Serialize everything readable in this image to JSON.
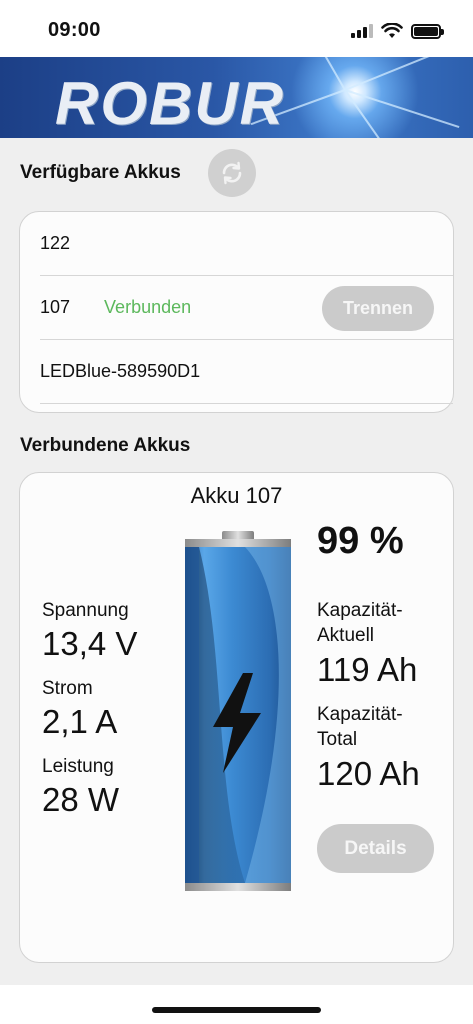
{
  "status_bar": {
    "time": "09:00"
  },
  "banner": {
    "logo_text": "ROBUR"
  },
  "available": {
    "title": "Verfügbare Akkus",
    "devices": [
      {
        "name": "122",
        "status": "",
        "action": ""
      },
      {
        "name": "107",
        "status": "Verbunden",
        "action": "Trennen"
      },
      {
        "name": "LEDBlue-589590D1",
        "status": "",
        "action": ""
      }
    ]
  },
  "connected": {
    "title": "Verbundene Akkus",
    "battery": {
      "name": "Akku 107",
      "percent": "99 %",
      "level": 0.99,
      "voltage_label": "Spannung",
      "voltage_value": "13,4 V",
      "current_label": "Strom",
      "current_value": "2,1 A",
      "power_label": "Leistung",
      "power_value": "28 W",
      "cap_current_label_1": "Kapazität-",
      "cap_current_label_2": "Aktuell",
      "cap_current_value": "119 Ah",
      "cap_total_label_1": "Kapazität-",
      "cap_total_label_2": "Total",
      "cap_total_value": "120 Ah",
      "details_label": "Details"
    }
  },
  "icons": {
    "refresh": "refresh-icon",
    "lightning": "lightning-icon",
    "signal": "cellular-signal-icon",
    "wifi": "wifi-icon",
    "battery": "battery-icon"
  },
  "colors": {
    "connected_status": "#5cb85c",
    "button_bg": "#cbcbcb",
    "banner": "#2a57a6",
    "battery_blue": "#3f8fd6"
  }
}
